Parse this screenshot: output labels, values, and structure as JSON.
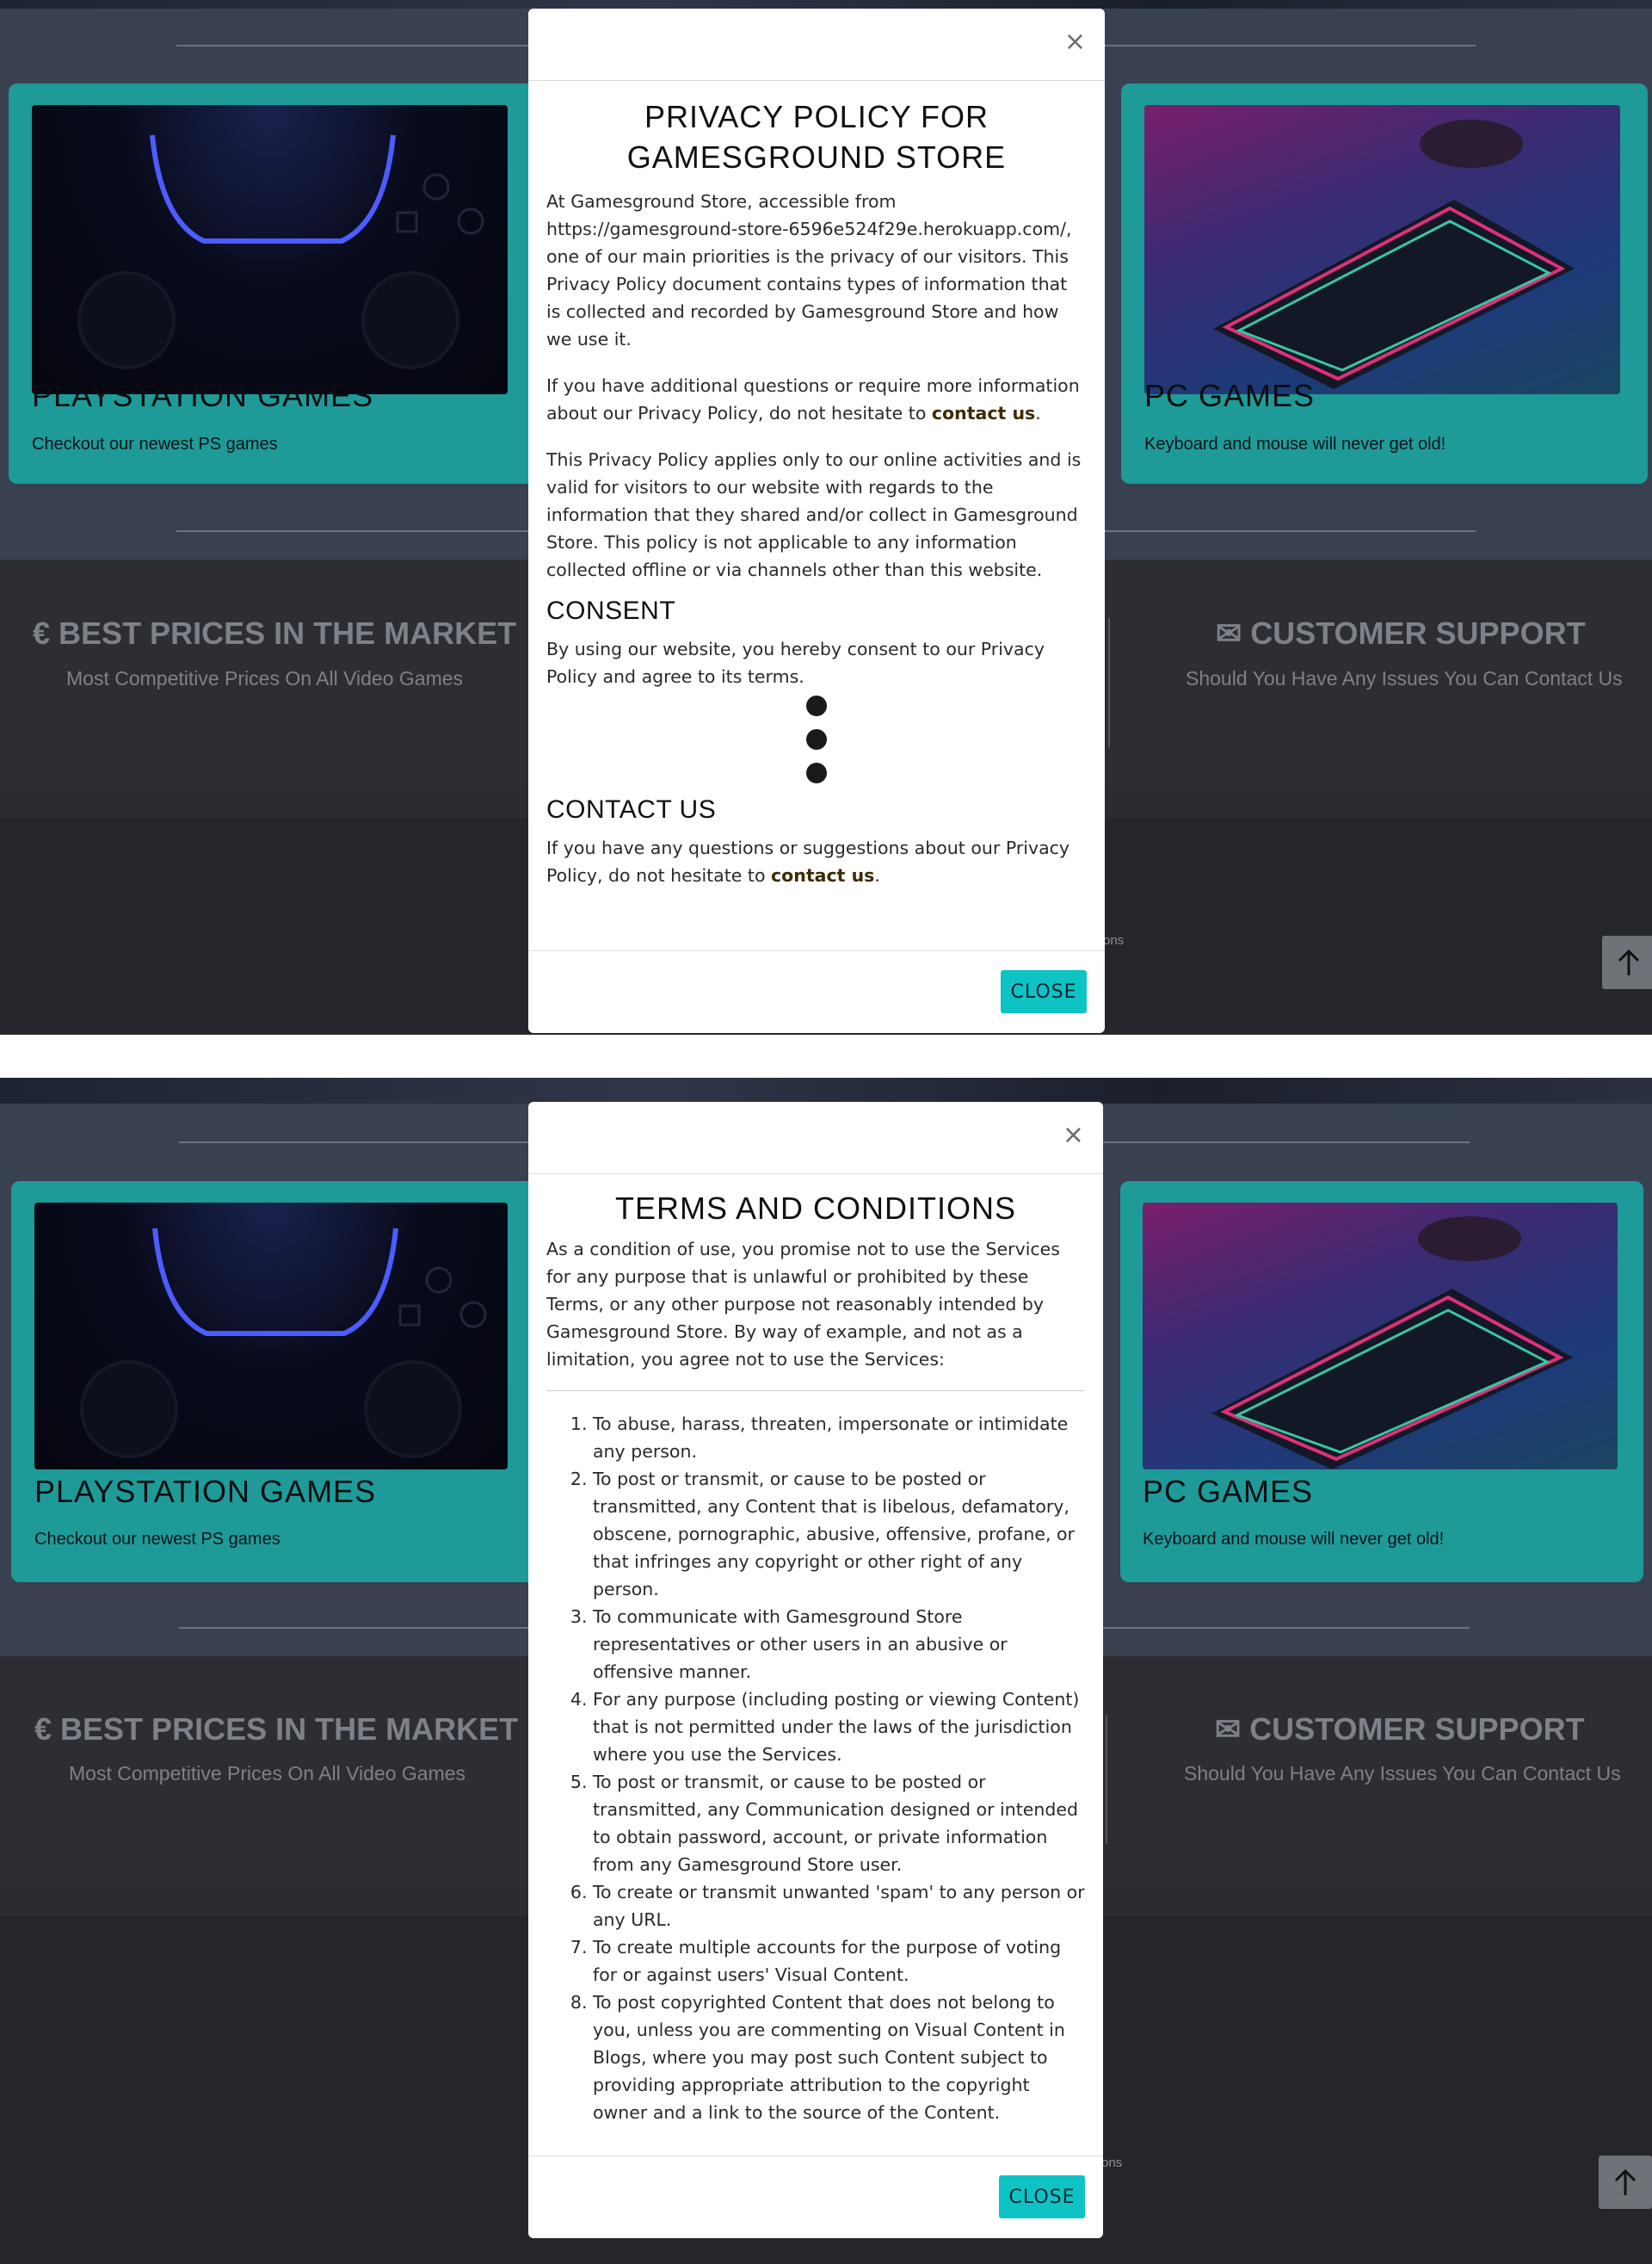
{
  "cards": {
    "left": {
      "title": "PLAYSTATION GAMES",
      "subtitle": "Checkout our newest PS games"
    },
    "right": {
      "title": "PC GAMES",
      "subtitle": "Keyboard and mouse will never get old!"
    }
  },
  "features": {
    "left": {
      "icon": "euro-icon",
      "glyph": "€",
      "title": "BEST PRICES IN THE MARKET",
      "subtitle": "Most Competitive Prices On All Video Games"
    },
    "right": {
      "icon": "envelope-icon",
      "glyph": "✉",
      "title": "CUSTOMER SUPPORT",
      "subtitle": "Should You Have Any Issues You Can Contact Us"
    }
  },
  "footer_fragment": "ons",
  "scroll_top": {
    "icon": "arrow-up-icon",
    "glyph": "↑"
  },
  "privacy_modal": {
    "close_x": "×",
    "title": "PRIVACY POLICY FOR GAMESGROUND STORE",
    "intro": "At Gamesground Store, accessible from https://gamesground-store-6596e524f29e.herokuapp.com/, one of our main priorities is the privacy of our visitors. This Privacy Policy document contains types of information that is collected and recorded by Gamesground Store and how we use it.",
    "questions_text": "If you have additional questions or require more information about our Privacy Policy, do not hesitate to ",
    "questions_link": "contact us",
    "scope": "This Privacy Policy applies only to our online activities and is valid for visitors to our website with regards to the information that they shared and/or collect in Gamesground Store. This policy is not applicable to any information collected offline or via channels other than this website.",
    "consent_heading": "CONSENT",
    "consent_text": "By using our website, you hereby consent to our Privacy Policy and agree to its terms.",
    "contact_heading": "CONTACT US",
    "contact_text": "If you have any questions or suggestions about our Privacy Policy, do not hesitate to ",
    "contact_link": "contact us",
    "close_button": "CLOSE"
  },
  "terms_modal": {
    "close_x": "×",
    "title": "TERMS AND CONDITIONS",
    "intro": "As a condition of use, you promise not to use the Services for any purpose that is unlawful or prohibited by these Terms, or any other purpose not reasonably intended by Gamesground Store. By way of example, and not as a limitation, you agree not to use the Services:",
    "items": [
      "To abuse, harass, threaten, impersonate or intimidate any person.",
      "To post or transmit, or cause to be posted or transmitted, any Content that is libelous, defamatory, obscene, pornographic, abusive, offensive, profane, or that infringes any copyright or other right of any person.",
      "To communicate with Gamesground Store representatives or other users in an abusive or offensive manner.",
      "For any purpose (including posting or viewing Content) that is not permitted under the laws of the jurisdiction where you use the Services.",
      "To post or transmit, or cause to be posted or transmitted, any Communication designed or intended to obtain password, account, or private information from any Gamesground Store user.",
      "To create or transmit unwanted 'spam' to any person or any URL.",
      "To create multiple accounts for the purpose of voting for or against users' Visual Content.",
      "To post copyrighted Content that does not belong to you, unless you are commenting on Visual Content in Blogs, where you may post such Content subject to providing appropriate attribution to the copyright owner and a link to the source of the Content."
    ],
    "close_button": "CLOSE"
  }
}
